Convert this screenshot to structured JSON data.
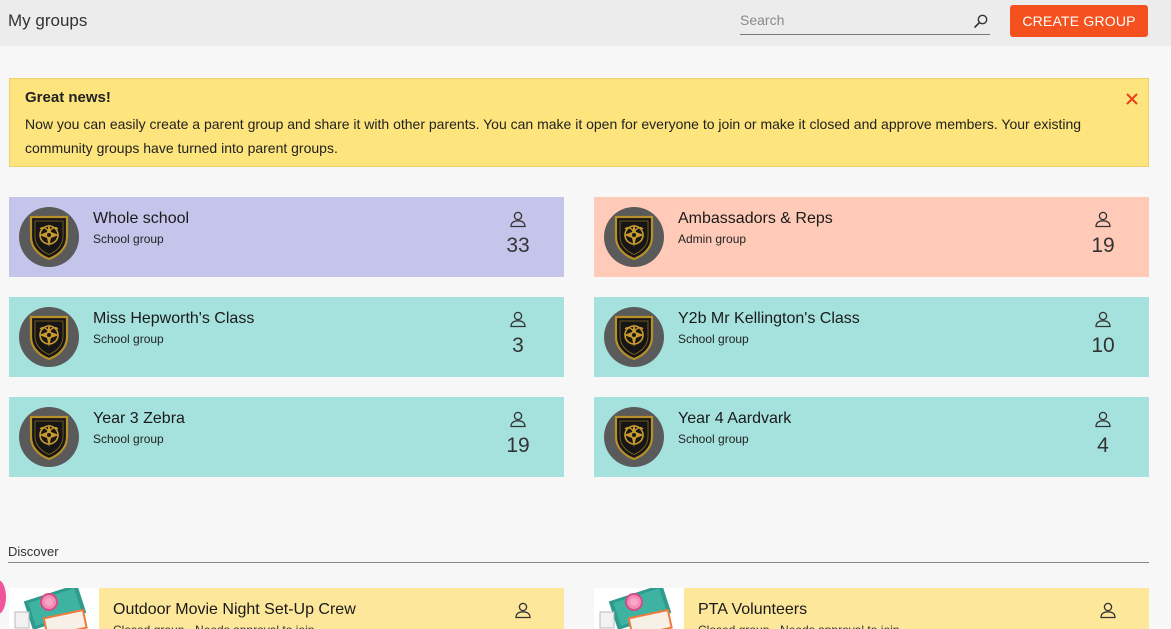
{
  "header": {
    "title": "My groups",
    "search_placeholder": "Search",
    "create_button_label": "CREATE GROUP"
  },
  "banner": {
    "title": "Great news!",
    "body": "Now you can easily create a parent group and share it with other parents. You can make it open for everyone to join or make it closed and approve members. Your existing community groups have turned into parent groups."
  },
  "groups": [
    {
      "name": "Whole school",
      "type": "School group",
      "members": "33",
      "color": "#c5c5ec"
    },
    {
      "name": "Ambassadors & Reps",
      "type": "Admin group",
      "members": "19",
      "color": "#ffcab7"
    },
    {
      "name": "Miss Hepworth's Class",
      "type": "School group",
      "members": "3",
      "color": "#a6e2dd"
    },
    {
      "name": "Y2b Mr Kellington's Class",
      "type": "School group",
      "members": "10",
      "color": "#a6e2dd"
    },
    {
      "name": "Year 3 Zebra",
      "type": "School group",
      "members": "19",
      "color": "#a6e2dd"
    },
    {
      "name": "Year 4 Aardvark",
      "type": "School group",
      "members": "4",
      "color": "#a6e2dd"
    }
  ],
  "discover": {
    "label": "Discover",
    "items": [
      {
        "title": "Outdoor Movie Night Set-Up Crew",
        "subtitle": "Closed group · Needs approval to join"
      },
      {
        "title": "PTA Volunteers",
        "subtitle": "Closed group · Needs approval to join"
      }
    ]
  },
  "colors": {
    "accent": "#f4511e",
    "banner": "#fde47c",
    "discover_card": "#fde79b"
  }
}
